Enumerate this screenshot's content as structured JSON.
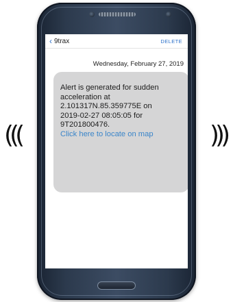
{
  "vibration": {
    "left": "(((",
    "right": ")))"
  },
  "topbar": {
    "back_label": "9trax",
    "delete_label": "DELETE"
  },
  "conversation": {
    "date": "Wednesday, February 27, 2019"
  },
  "message": {
    "lines": [
      "Alert is generated for sudden",
      "acceleration at",
      "2.101317N.85.359775E on",
      "2019-02-27 08:05:05 for",
      "9T201800476."
    ],
    "link_text": "Click here to locate on map"
  },
  "colors": {
    "link": "#3a85c9",
    "bubble": "#d5d5d6",
    "phone_body": "#2c3a4d"
  }
}
